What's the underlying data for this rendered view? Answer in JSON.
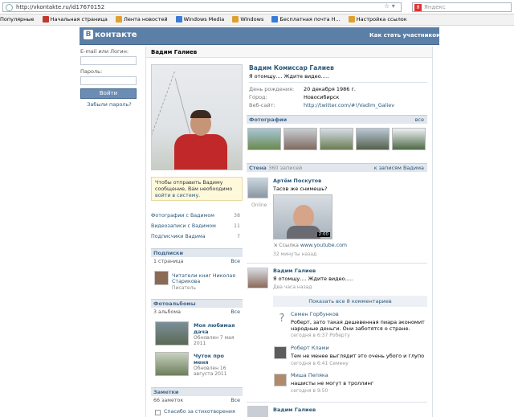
{
  "browser": {
    "url": "http://vkontakte.ru/id17670152",
    "search_placeholder": "Яндекс",
    "bookmarks": [
      {
        "label": "Популярные",
        "color": "#888888"
      },
      {
        "label": "Начальная страница",
        "color": "#c0392b"
      },
      {
        "label": "Лента новостей",
        "color": "#e0a030"
      },
      {
        "label": "Windows Media",
        "color": "#3a7bd5"
      },
      {
        "label": "Windows",
        "color": "#3a7bd5"
      },
      {
        "label": "Бесплатная почта H...",
        "color": "#3a7bd5"
      },
      {
        "label": "Настройка ссылок",
        "color": "#e0a030"
      }
    ]
  },
  "header": {
    "logo_letter": "B",
    "logo_text": "контакте",
    "howto": "Как стать участником?"
  },
  "login": {
    "email_label": "E-mail или Логин:",
    "password_label": "Пароль:",
    "login_button": "Войти",
    "forgot": "Забыли пароль?"
  },
  "profile": {
    "page_name": "Вадим Галиев",
    "full_name": "Вадим Комиссар Галиев",
    "status": "Я отомщу.... Ждите видео.....",
    "info": [
      {
        "key": "День рождения:",
        "value": "20 декабря 1986 г.",
        "link": false
      },
      {
        "key": "Город:",
        "value": "Новосибирск",
        "link": false
      },
      {
        "key": "Веб-сайт:",
        "value": "http://twitter.com/#!/Vadim_Galiev",
        "link": true
      }
    ],
    "send_message_text": "Чтобы отправить Вадиму сообщение, Вам необходимо ",
    "send_message_link": "войти в систему.",
    "left_links": [
      {
        "label": "Фотографии с Вадимом",
        "count": "38"
      },
      {
        "label": "Видеозаписи с Вадимом",
        "count": "11"
      },
      {
        "label": "Подписчики Вадима",
        "count": "7"
      }
    ]
  },
  "subscriptions": {
    "title": "Подписки",
    "count": "1 страница",
    "all": "Все",
    "item_name": "Читатели книг Николая Старикова",
    "item_role": "Писатель"
  },
  "albums": {
    "title": "Фотоальбомы",
    "count": "3 альбома",
    "all": "Все",
    "items": [
      {
        "name": "Моя любимая дача",
        "updated": "Обновлен 7 мая 2011"
      },
      {
        "name": "Чуток про меня",
        "updated": "Обновлен 16 августа 2011"
      }
    ]
  },
  "notes": {
    "title": "Заметки",
    "count": "66 заметок",
    "all": "Все",
    "first": "Спасибо за стихотворения"
  },
  "photos_section": {
    "title": "Фотографии",
    "all": "все"
  },
  "wall": {
    "title": "Стена",
    "count": "360 записей",
    "link": "к записям Вадима",
    "posts": [
      {
        "author": "Артём Поскутов",
        "online": "Online",
        "text": "Тасов же снимешь?",
        "video_duration": "2:00",
        "link_label": "Ссылка",
        "link_url": "www.youtube.com",
        "date": "32 минуты назад"
      },
      {
        "author": "Вадим Галиев",
        "text": "Я отомщу.... Ждите видео.....",
        "date": "Два часа назад",
        "show_comments": "Показать все 8 комментариев"
      }
    ],
    "comments": [
      {
        "author": "Семен Горбунков",
        "text": "Роберт, зато такая дешевенная пиара экономит народные деньги. Они заботятся о стране.",
        "date": "сегодня в 6:37 Роберту"
      },
      {
        "author": "Роберт Клами",
        "text": "Тем не менее выглядит это очень убого и глупо",
        "date": "сегодня в 6:41 Семену"
      },
      {
        "author": "Миша Пепяка",
        "text": "нашисты не могут в троллинг",
        "date": "сегодня в 9:50"
      }
    ],
    "next_author": "Вадим Галиев"
  }
}
